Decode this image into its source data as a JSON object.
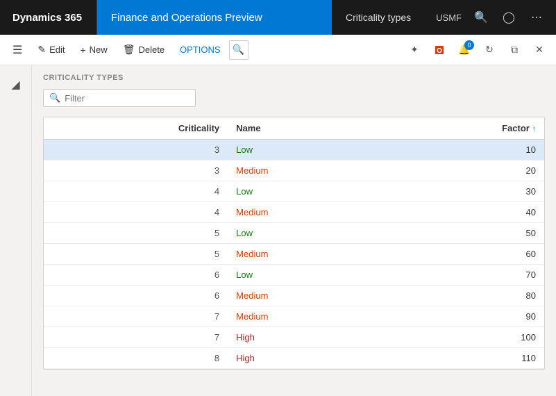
{
  "topNav": {
    "dynamics365": "Dynamics 365",
    "appName": "Finance and Operations Preview",
    "breadcrumb": "Criticality types",
    "company": "USMF"
  },
  "toolbar": {
    "edit": "Edit",
    "new": "New",
    "delete": "Delete",
    "options": "OPTIONS"
  },
  "section": {
    "title": "CRITICALITY TYPES"
  },
  "filter": {
    "placeholder": "Filter"
  },
  "table": {
    "columns": {
      "criticality": "Criticality",
      "name": "Name",
      "factor": "Factor"
    },
    "rows": [
      {
        "criticality": "3",
        "name": "Low",
        "name_class": "name-low",
        "factor": "10",
        "selected": true
      },
      {
        "criticality": "3",
        "name": "Medium",
        "name_class": "name-medium",
        "factor": "20",
        "selected": false
      },
      {
        "criticality": "4",
        "name": "Low",
        "name_class": "name-low",
        "factor": "30",
        "selected": false
      },
      {
        "criticality": "4",
        "name": "Medium",
        "name_class": "name-medium",
        "factor": "40",
        "selected": false
      },
      {
        "criticality": "5",
        "name": "Low",
        "name_class": "name-low",
        "factor": "50",
        "selected": false
      },
      {
        "criticality": "5",
        "name": "Medium",
        "name_class": "name-medium",
        "factor": "60",
        "selected": false
      },
      {
        "criticality": "6",
        "name": "Low",
        "name_class": "name-low",
        "factor": "70",
        "selected": false
      },
      {
        "criticality": "6",
        "name": "Medium",
        "name_class": "name-medium",
        "factor": "80",
        "selected": false
      },
      {
        "criticality": "7",
        "name": "Medium",
        "name_class": "name-medium",
        "factor": "90",
        "selected": false
      },
      {
        "criticality": "7",
        "name": "High",
        "name_class": "name-high",
        "factor": "100",
        "selected": false
      },
      {
        "criticality": "8",
        "name": "High",
        "name_class": "name-high",
        "factor": "110",
        "selected": false
      }
    ]
  }
}
